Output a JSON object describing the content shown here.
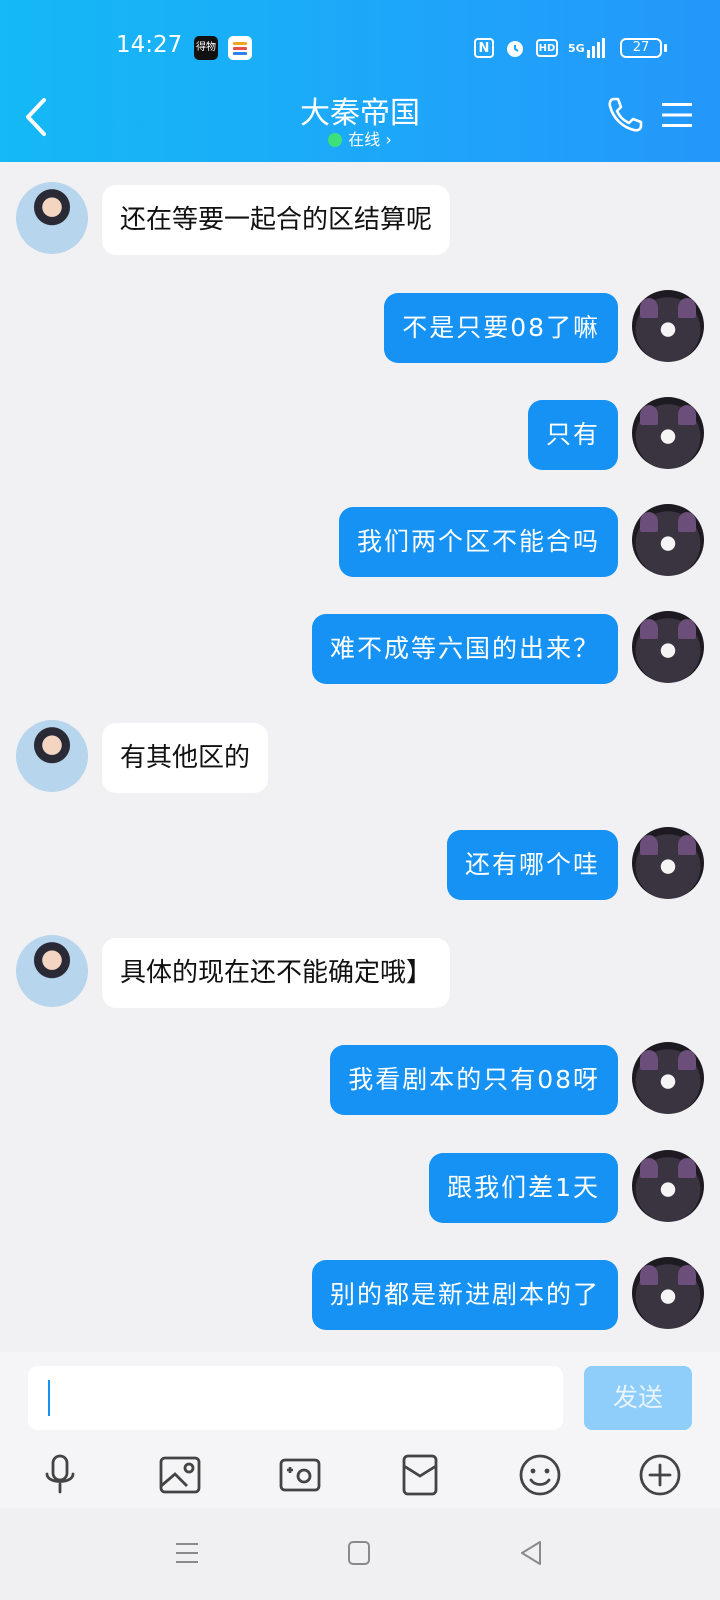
{
  "status": {
    "time": "14:27",
    "battery": "27",
    "network": "5G",
    "hd": "HD",
    "nfc": "N",
    "app_badge": "得物"
  },
  "header": {
    "title": "大秦帝国",
    "status": "在线 ›"
  },
  "messages": [
    {
      "side": "left",
      "text": "还在等要一起合的区结算呢"
    },
    {
      "side": "right",
      "text": "不是只要08了嘛"
    },
    {
      "side": "right",
      "text": "只有"
    },
    {
      "side": "right",
      "text": "我们两个区不能合吗"
    },
    {
      "side": "right",
      "text": "难不成等六国的出来？"
    },
    {
      "side": "left",
      "text": "有其他区的"
    },
    {
      "side": "right",
      "text": "还有哪个哇"
    },
    {
      "side": "left",
      "text": "具体的现在还不能确定哦】"
    },
    {
      "side": "right",
      "text": "我看剧本的只有08呀"
    },
    {
      "side": "right",
      "text": "跟我们差1天"
    },
    {
      "side": "right",
      "text": "别的都是新进剧本的了"
    }
  ],
  "composer": {
    "input_value": "",
    "send_label": "发送"
  },
  "toolbar": [
    "mic-icon",
    "image-icon",
    "camera-icon",
    "red-packet-icon",
    "emoji-icon",
    "plus-icon"
  ],
  "colors": {
    "accent": "#1592f4",
    "header": "#1ea5fa",
    "online": "#3ee07a"
  }
}
